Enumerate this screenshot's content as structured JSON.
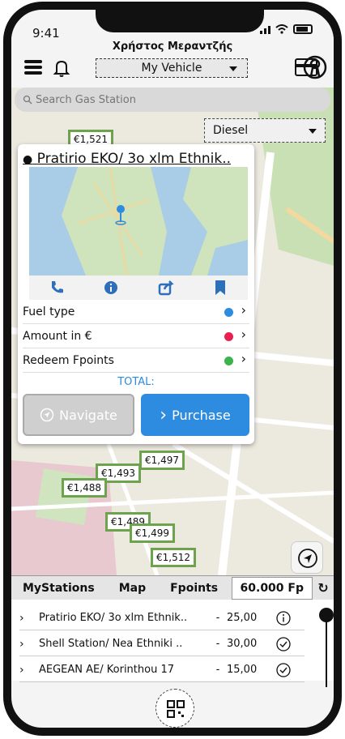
{
  "status_bar": {
    "time": "9:41"
  },
  "header": {
    "user_name": "Χρήστος Μεραντζής",
    "vehicle_select": "My Vehicle"
  },
  "search": {
    "placeholder": "Search Gas Station"
  },
  "fuel_filter": {
    "selected": "Diesel"
  },
  "map_pins": [
    {
      "label": "€1,521"
    },
    {
      "label": "€1,497"
    },
    {
      "label": "€1,493"
    },
    {
      "label": "€1,488"
    },
    {
      "label": "€1,489"
    },
    {
      "label": "€1,499"
    },
    {
      "label": "€1,512"
    }
  ],
  "station_card": {
    "title": "Pratirio EKO/ 3o xlm Ethnik..",
    "rows": [
      {
        "label": "Fuel type",
        "color": "#2d8be0"
      },
      {
        "label": "Amount in €",
        "color": "#e8204f"
      },
      {
        "label": "Redeem Fpoints",
        "color": "#3bb34a"
      }
    ],
    "total_label": "TOTAL:",
    "navigate_label": "Navigate",
    "purchase_label": "Purchase"
  },
  "tabs": {
    "my_stations": "MyStations",
    "map": "Map",
    "fpoints": "Fpoints",
    "balance": "60.000 Fp"
  },
  "stations": [
    {
      "name": "Pratirio EKO/ 3o xlm Ethnik..",
      "sep": "-",
      "price": "25,00",
      "status_icon": "info-icon"
    },
    {
      "name": "Shell Station/ Nea Ethniki ..",
      "sep": "-",
      "price": "30,00",
      "status_icon": "check-circle-icon"
    },
    {
      "name": "AEGEAN AE/ Korinthou 17",
      "sep": "-",
      "price": "15,00",
      "status_icon": "check-circle-icon"
    }
  ],
  "colors": {
    "accent": "#2d8be0",
    "pin_border": "#6da34d"
  }
}
